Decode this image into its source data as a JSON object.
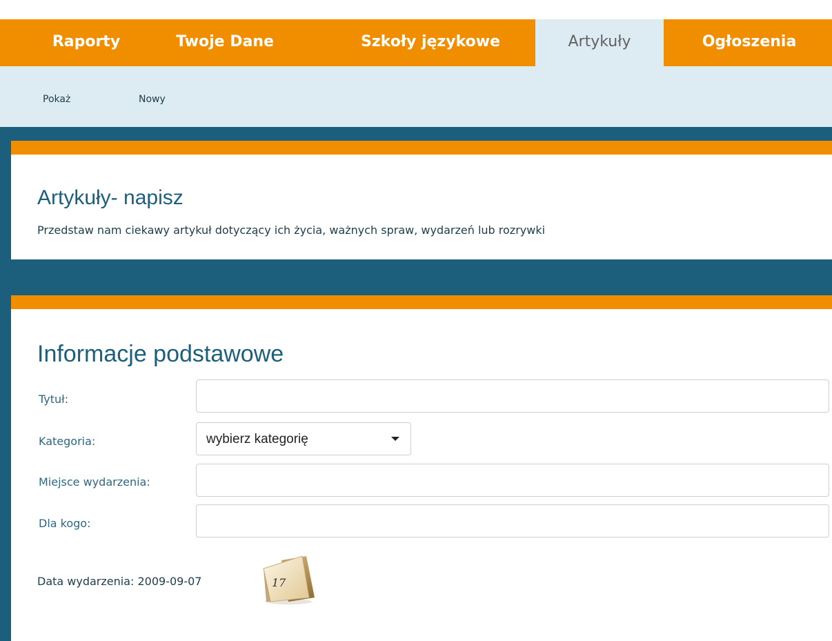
{
  "nav": {
    "tabs": [
      {
        "label": "Raporty"
      },
      {
        "label": "Twoje Dane"
      },
      {
        "label": "Szkoły językowe"
      },
      {
        "label": "Artykuły"
      },
      {
        "label": "Ogłoszenia"
      }
    ],
    "active": "Artykuły"
  },
  "subnav": {
    "items": [
      {
        "label": "Pokaż"
      },
      {
        "label": "Nowy"
      }
    ]
  },
  "header": {
    "title": "Artykuły- napisz",
    "subtitle": "Przedstaw nam ciekawy artykuł dotyczący ich życia, ważnych spraw, wydarzeń lub rozrywki"
  },
  "form": {
    "section_title": "Informacje podstawowe",
    "title_label": "Tytuł:",
    "title_value": "",
    "category_label": "Kategoria:",
    "category_value": "wybierz kategorię",
    "place_label": "Miejsce wydarzenia:",
    "place_value": "",
    "audience_label": "Dla kogo:",
    "audience_value": "",
    "date_label": "Data wydarzenia: 2009-09-07",
    "calendar_number": "17"
  },
  "colors": {
    "orange": "#f18e00",
    "teal": "#1c5f7c",
    "light_blue": "#dcecf2"
  },
  "icons": {
    "calendar": "calendar-icon",
    "dropdown": "chevron-down-icon"
  }
}
